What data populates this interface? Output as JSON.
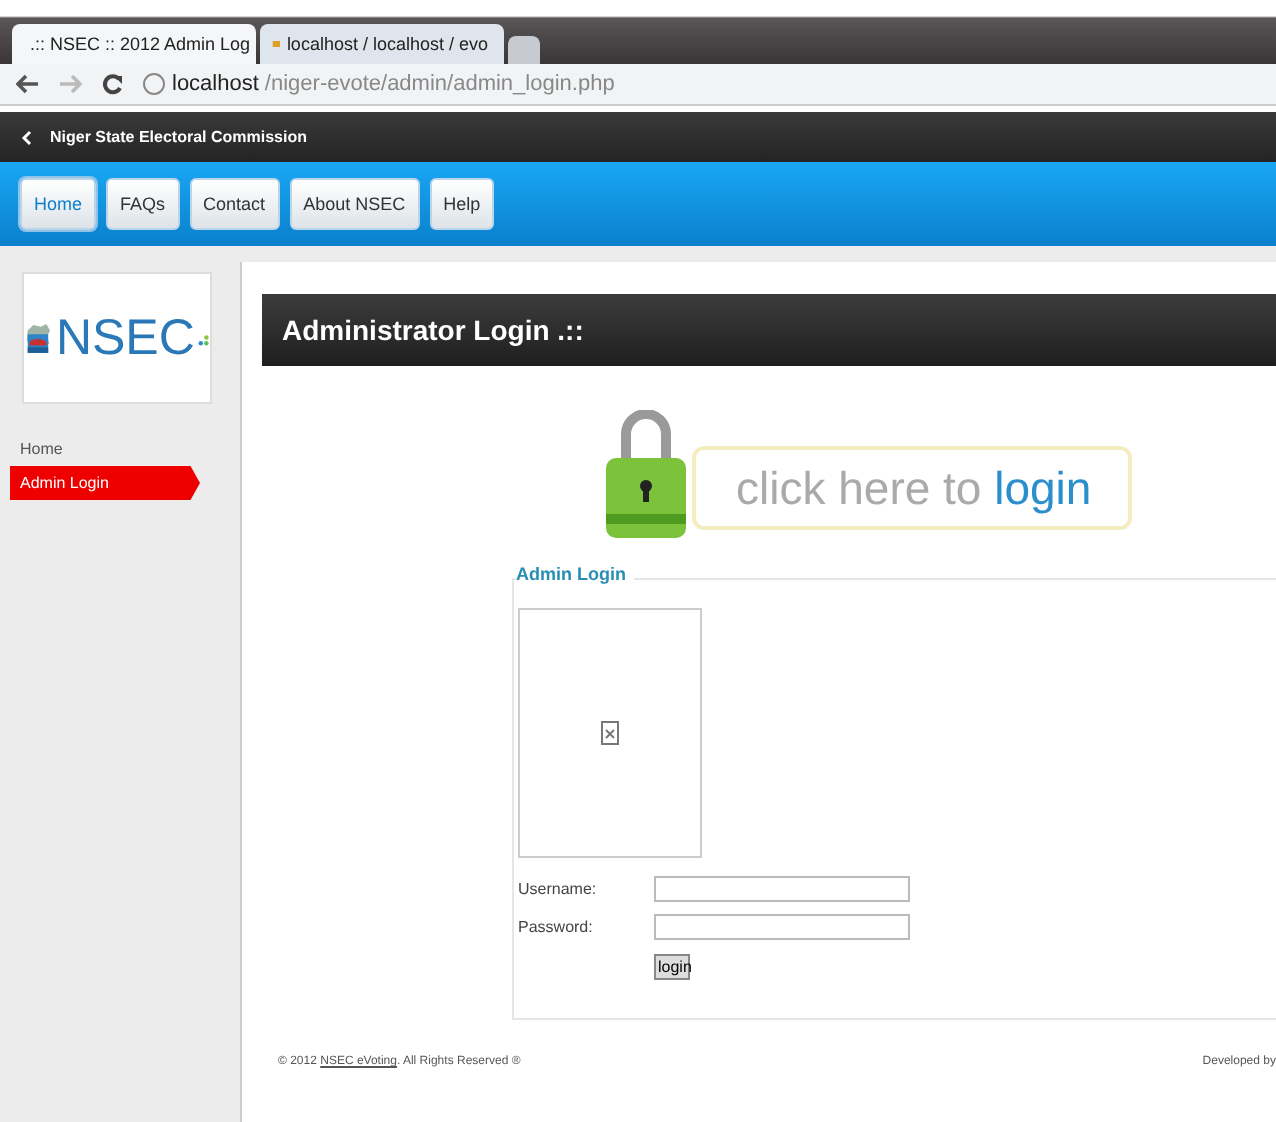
{
  "browser": {
    "tabs": [
      {
        "title": ".:: NSEC :: 2012 Admin Log",
        "selected": true
      },
      {
        "title": "localhost / localhost / evo",
        "selected": false
      }
    ],
    "address": {
      "host": "localhost",
      "path": "/niger-evote/admin/admin_login.php"
    }
  },
  "topbar": {
    "title": "Niger State Electoral Commission"
  },
  "nav": [
    {
      "label": "Home",
      "selected": true
    },
    {
      "label": "FAQs",
      "selected": false
    },
    {
      "label": "Contact",
      "selected": false
    },
    {
      "label": "About NSEC",
      "selected": false
    },
    {
      "label": "Help",
      "selected": false
    }
  ],
  "sidebar": {
    "logo": "NSEC",
    "items": [
      {
        "label": "Home",
        "selected": false
      },
      {
        "label": "Admin Login",
        "selected": true
      }
    ]
  },
  "main": {
    "header": "Administrator Login .::",
    "banner": {
      "text": "click here to",
      "link": "login"
    },
    "form": {
      "legend": "Admin Login",
      "fields": [
        {
          "label": "Username:"
        },
        {
          "label": "Password:"
        }
      ],
      "button": "login"
    }
  },
  "footer": {
    "before": "© 2012 ",
    "link": "NSEC eVoting",
    "after": ". All Rights Reserved ®",
    "right": "Developed by"
  }
}
